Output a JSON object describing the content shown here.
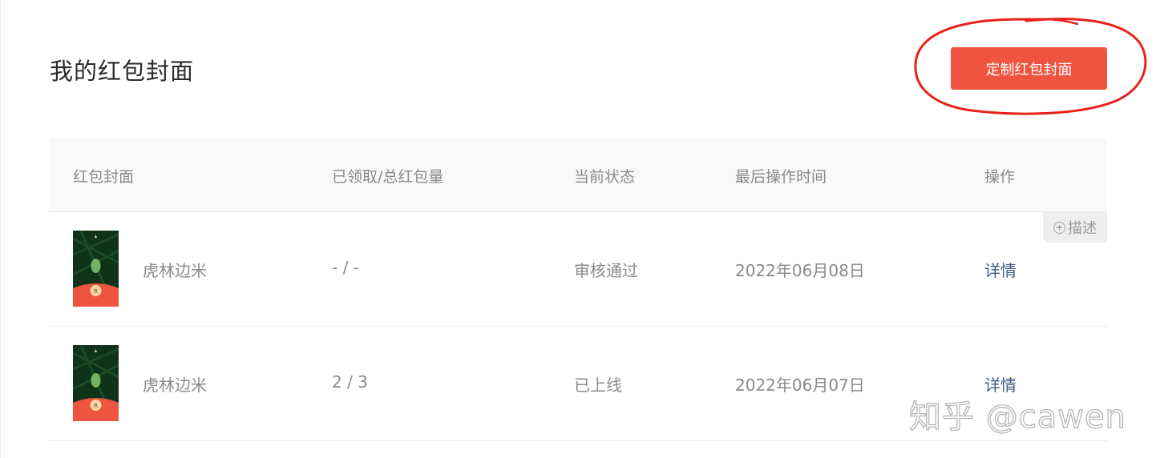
{
  "page": {
    "title": "我的红包封面",
    "create_button_label": "定制红包封面"
  },
  "table": {
    "headers": [
      "红包封面",
      "已领取/总红包量",
      "当前状态",
      "最后操作时间",
      "操作"
    ],
    "describe_tag": "描述",
    "rows": [
      {
        "cover_name": "虎林边米",
        "claimed_total": "- / -",
        "status": "审核通过",
        "last_operation_time": "2022年06月08日",
        "action": "详情"
      },
      {
        "cover_name": "虎林边米",
        "claimed_total": "2 / 3",
        "status": "已上线",
        "last_operation_time": "2022年06月07日",
        "action": "详情"
      }
    ]
  },
  "watermark": "知乎 @cawen",
  "colors": {
    "accent": "#ef5440",
    "annotation": "#e8221b",
    "link": "#3d5b85",
    "header_bg": "#f9f9f9",
    "cover_green": "#0f3318",
    "cover_red": "#ef5440"
  },
  "icons": [
    "plus-circle-icon",
    "cover-thumbnail-image"
  ]
}
